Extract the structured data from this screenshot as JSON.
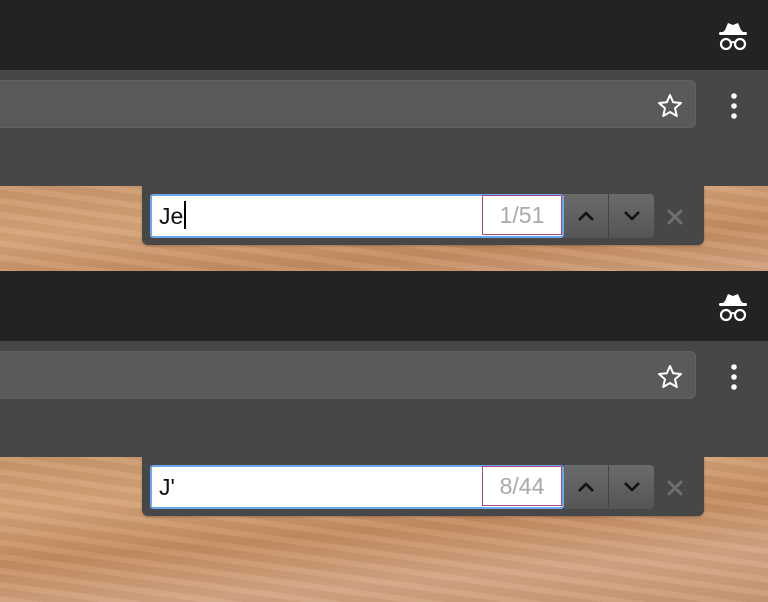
{
  "screens": [
    {
      "find": {
        "query": "Je",
        "match_count": "1/51",
        "show_caret": true
      }
    },
    {
      "find": {
        "query": "J'",
        "match_count": "8/44",
        "show_caret": false
      }
    }
  ],
  "icons": {
    "incognito": "incognito-icon",
    "bookmark": "star-icon",
    "menu": "three-dot-menu-icon",
    "find_prev": "chevron-up-icon",
    "find_next": "chevron-down-icon",
    "find_close": "close-icon"
  },
  "colors": {
    "titlebar": "#232323",
    "toolbar": "#474747",
    "omnibox": "#5a5a5a",
    "find_focus_ring": "#6aa7ee",
    "match_count_outline": "#b0457c",
    "match_count_text": "#a9a9a9"
  }
}
